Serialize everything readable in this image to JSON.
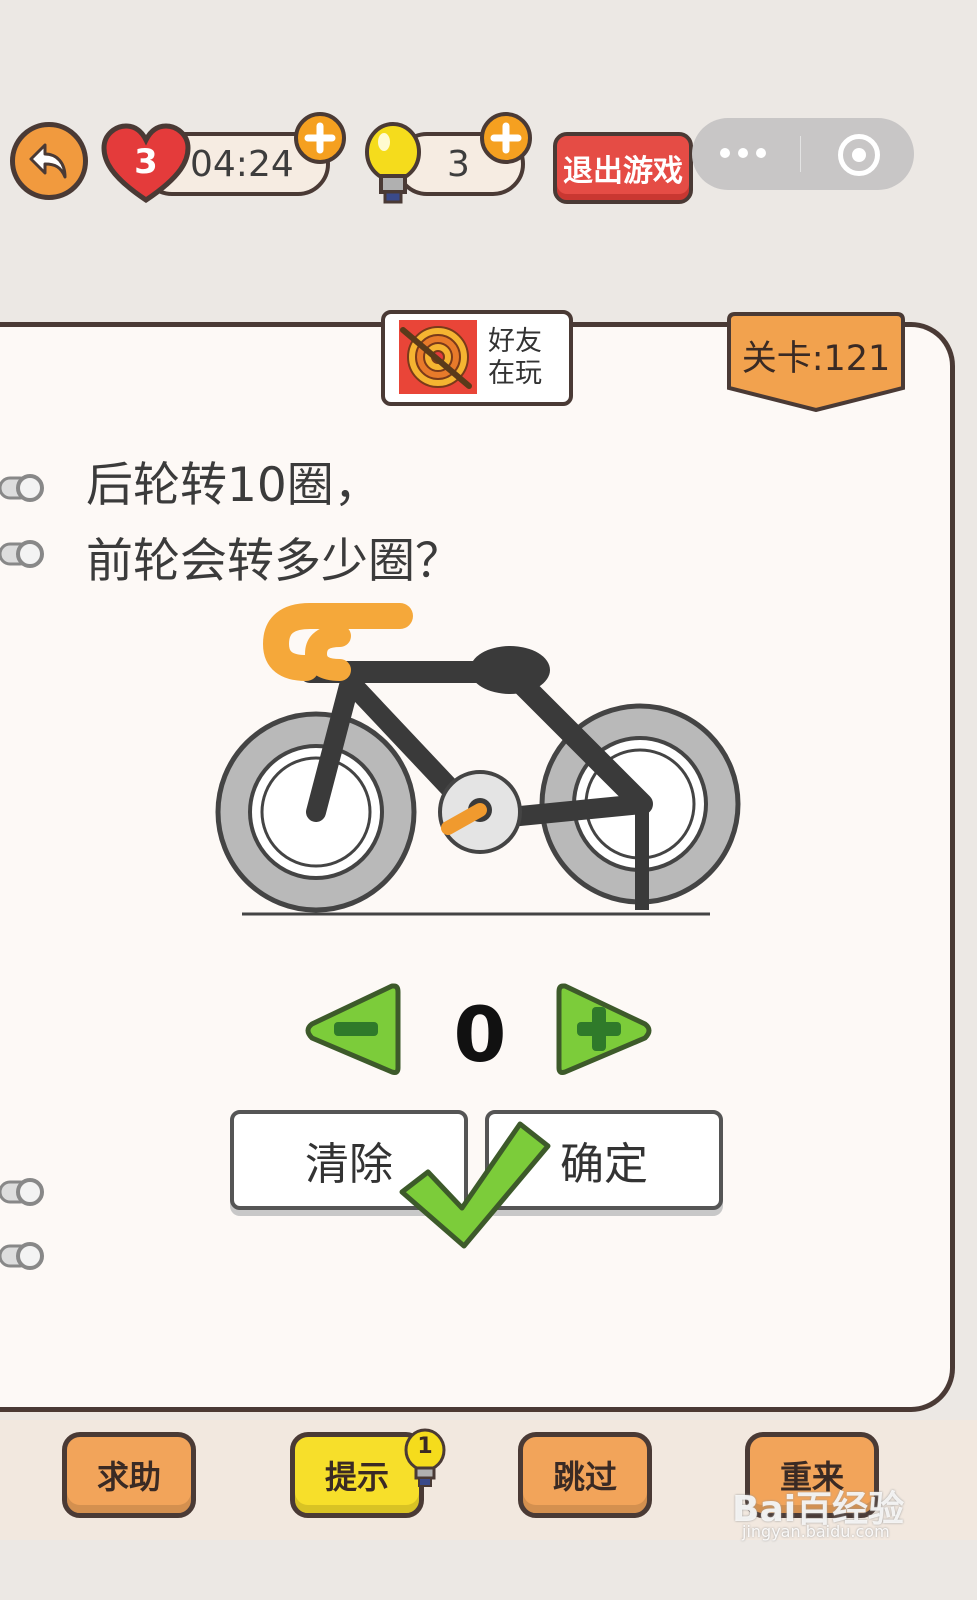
{
  "topbar": {
    "lives": "3",
    "timer": "04:24",
    "hints": "3",
    "exit_label": "退出游戏",
    "icons": [
      "back-arrow-icon",
      "heart-icon",
      "plus-icon",
      "bulb-icon",
      "more-dots-icon",
      "target-icon"
    ]
  },
  "friends_badge": {
    "line1": "好友",
    "line2": "在玩"
  },
  "level": {
    "label": "关卡:121"
  },
  "question": {
    "line1": "后轮转10圈，",
    "line2": "前轮会转多少圈？"
  },
  "stepper": {
    "value": "0"
  },
  "actions": {
    "clear_label": "清除",
    "confirm_label": "确定"
  },
  "bottom": {
    "help_label": "求助",
    "hint_label": "提示",
    "hint_badge": "1",
    "skip_label": "跳过",
    "restart_label": "重来"
  },
  "watermark": {
    "brand": "Bai百经验",
    "url": "jingyan.baidu.com"
  },
  "colors": {
    "accent_orange": "#f19a3e",
    "exit_red": "#e54c45",
    "green": "#7ccc3a",
    "hint_yellow": "#f7df2a"
  }
}
